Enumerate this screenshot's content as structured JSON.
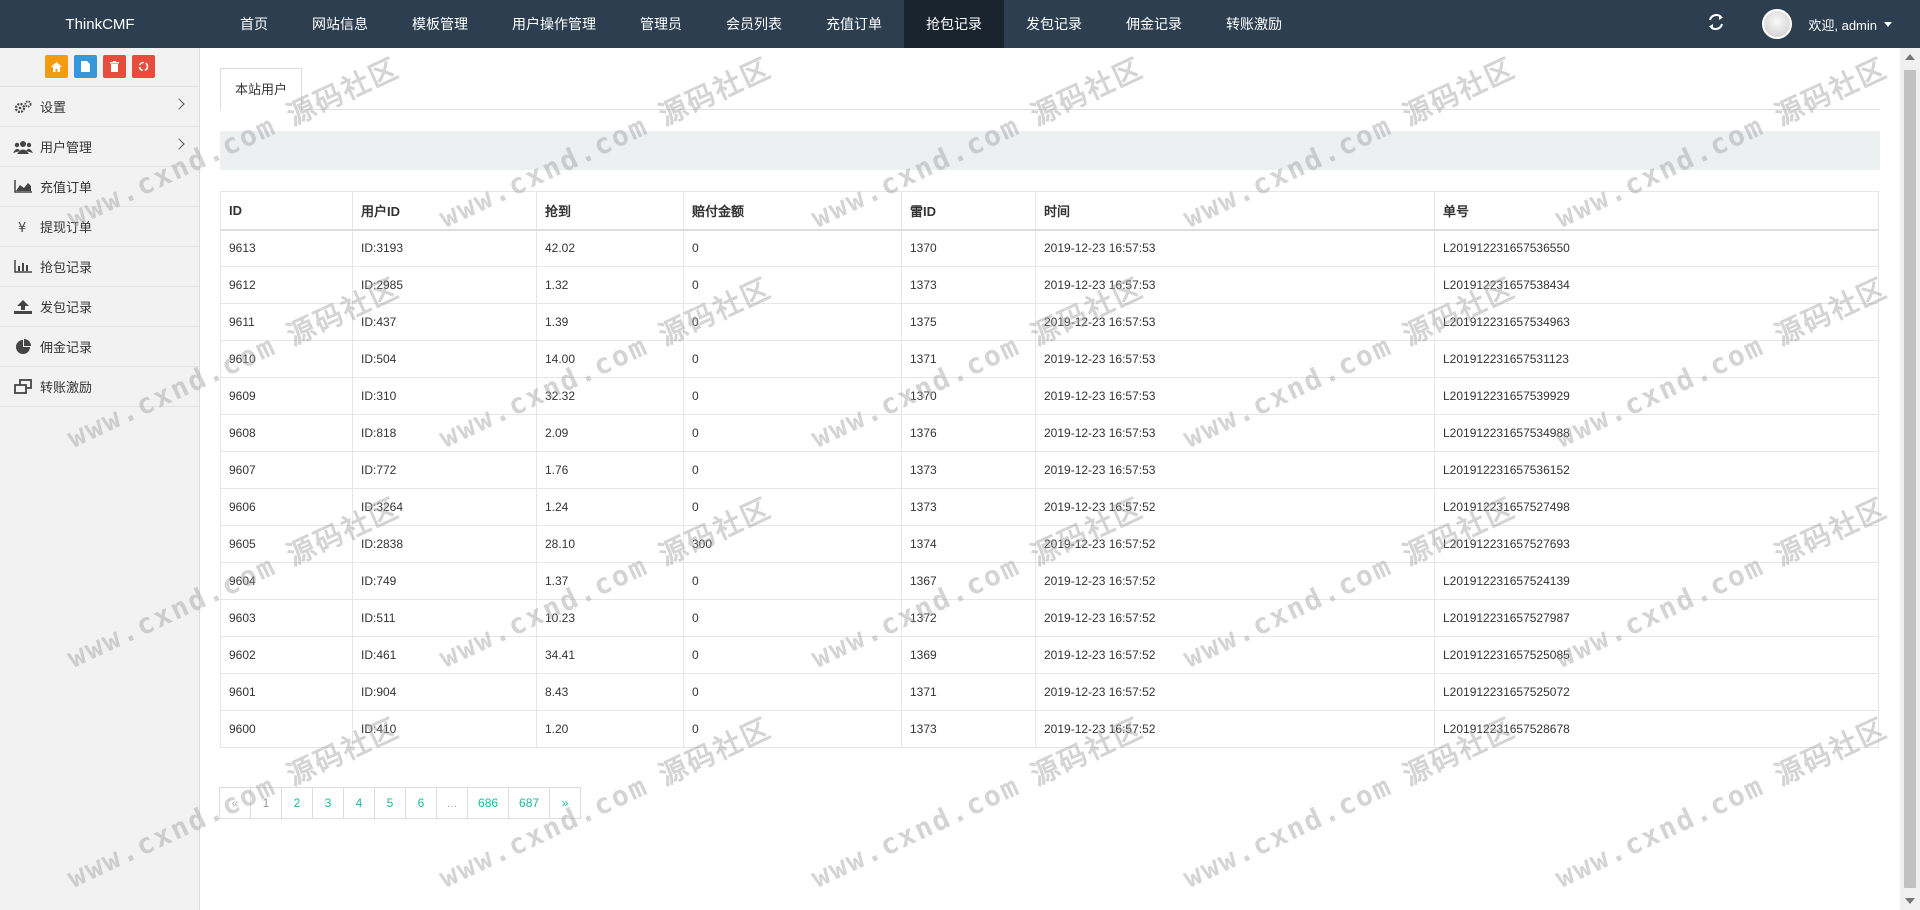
{
  "navbar": {
    "brand": "ThinkCMF",
    "items": [
      "首页",
      "网站信息",
      "模板管理",
      "用户操作管理",
      "管理员",
      "会员列表",
      "充值订单",
      "抢包记录",
      "发包记录",
      "佣金记录",
      "转账激励"
    ],
    "active_index": 7,
    "refresh_icon": "refresh-icon",
    "welcome": "欢迎, admin"
  },
  "sidebar": {
    "shortcuts": [
      "home-icon",
      "file-icon",
      "trash-icon",
      "recycle-icon"
    ],
    "items": [
      {
        "label": "设置",
        "icon": "cogs-icon",
        "has_children": true
      },
      {
        "label": "用户管理",
        "icon": "users-icon",
        "has_children": true
      },
      {
        "label": "充值订单",
        "icon": "area-chart-icon",
        "has_children": false
      },
      {
        "label": "提现订单",
        "icon": "yen-icon",
        "has_children": false
      },
      {
        "label": "抢包记录",
        "icon": "bar-chart-icon",
        "has_children": false
      },
      {
        "label": "发包记录",
        "icon": "upload-icon",
        "has_children": false
      },
      {
        "label": "佣金记录",
        "icon": "pie-chart-icon",
        "has_children": false
      },
      {
        "label": "转账激励",
        "icon": "window-restore-icon",
        "has_children": false
      }
    ]
  },
  "main": {
    "tab": "本站用户",
    "table": {
      "headers": [
        "ID",
        "用户ID",
        "抢到",
        "赔付金额",
        "雷ID",
        "时间",
        "单号"
      ],
      "rows": [
        [
          "9613",
          "ID:3193",
          "42.02",
          "0",
          "1370",
          "2019-12-23 16:57:53",
          "L201912231657536550"
        ],
        [
          "9612",
          "ID:2985",
          "1.32",
          "0",
          "1373",
          "2019-12-23 16:57:53",
          "L201912231657538434"
        ],
        [
          "9611",
          "ID:437",
          "1.39",
          "0",
          "1375",
          "2019-12-23 16:57:53",
          "L201912231657534963"
        ],
        [
          "9610",
          "ID:504",
          "14.00",
          "0",
          "1371",
          "2019-12-23 16:57:53",
          "L201912231657531123"
        ],
        [
          "9609",
          "ID:310",
          "32.32",
          "0",
          "1370",
          "2019-12-23 16:57:53",
          "L201912231657539929"
        ],
        [
          "9608",
          "ID:818",
          "2.09",
          "0",
          "1376",
          "2019-12-23 16:57:53",
          "L201912231657534988"
        ],
        [
          "9607",
          "ID:772",
          "1.76",
          "0",
          "1373",
          "2019-12-23 16:57:53",
          "L201912231657536152"
        ],
        [
          "9606",
          "ID:3264",
          "1.24",
          "0",
          "1373",
          "2019-12-23 16:57:52",
          "L201912231657527498"
        ],
        [
          "9605",
          "ID:2838",
          "28.10",
          "300",
          "1374",
          "2019-12-23 16:57:52",
          "L201912231657527693"
        ],
        [
          "9604",
          "ID:749",
          "1.37",
          "0",
          "1367",
          "2019-12-23 16:57:52",
          "L201912231657524139"
        ],
        [
          "9603",
          "ID:511",
          "10.23",
          "0",
          "1372",
          "2019-12-23 16:57:52",
          "L201912231657527987"
        ],
        [
          "9602",
          "ID:461",
          "34.41",
          "0",
          "1369",
          "2019-12-23 16:57:52",
          "L201912231657525085"
        ],
        [
          "9601",
          "ID:904",
          "8.43",
          "0",
          "1371",
          "2019-12-23 16:57:52",
          "L201912231657525072"
        ],
        [
          "9600",
          "ID:410",
          "1.20",
          "0",
          "1373",
          "2019-12-23 16:57:52",
          "L201912231657528678"
        ]
      ]
    },
    "pagination": [
      "«",
      "1",
      "2",
      "3",
      "4",
      "5",
      "6",
      "...",
      "686",
      "687",
      "»"
    ],
    "current_page": "1"
  },
  "watermark": {
    "url": "www.cxnd.com",
    "cn": "源码社区"
  },
  "colors": {
    "navbar_bg": "#2c3e50",
    "navbar_active": "#1a242f",
    "link": "#18bc9c",
    "shortcut_orange": "#f39c12",
    "shortcut_blue": "#3498db",
    "shortcut_red": "#e74c3c"
  }
}
